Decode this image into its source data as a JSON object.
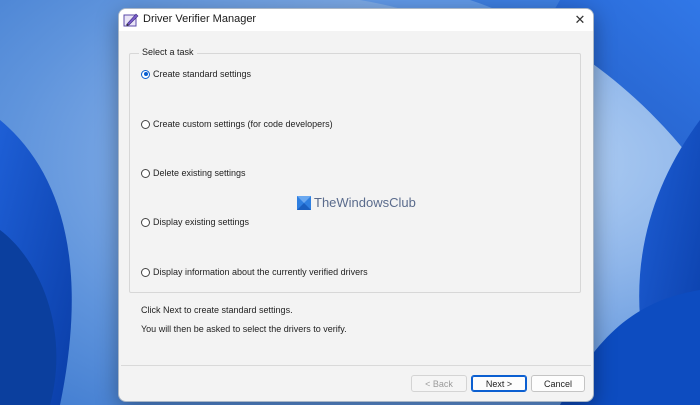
{
  "window": {
    "title": "Driver Verifier Manager",
    "close_glyph": "✕"
  },
  "task_group": {
    "label": "Select a task",
    "options": [
      {
        "label": "Create standard settings",
        "checked": true
      },
      {
        "label": "Create custom settings (for code developers)",
        "checked": false
      },
      {
        "label": "Delete existing settings",
        "checked": false
      },
      {
        "label": "Display existing settings",
        "checked": false
      },
      {
        "label": "Display information about the currently verified drivers",
        "checked": false
      }
    ]
  },
  "description": {
    "line1": "Click Next to create standard settings.",
    "line2": "You will then be asked to select the drivers to verify."
  },
  "buttons": {
    "back": "< Back",
    "next": "Next >",
    "cancel": "Cancel"
  },
  "watermark": {
    "text": "TheWindowsClub"
  },
  "colors": {
    "accent": "#0b5fd1",
    "window_bg": "#f3f3f3",
    "desktop_blue": "#3f7bd0"
  }
}
